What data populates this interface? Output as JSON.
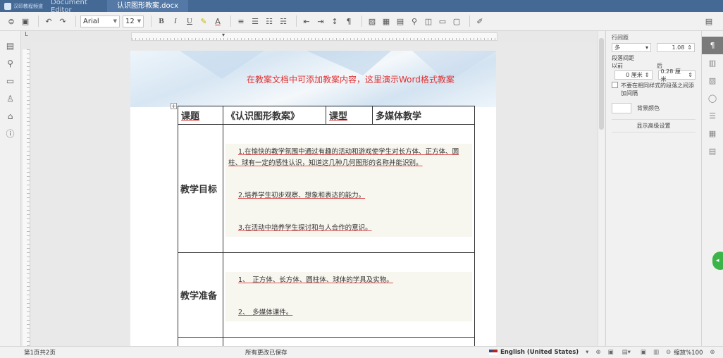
{
  "titlebar": {
    "logo_text": "汉印教程频道",
    "app_name": "Document Editor",
    "doc_tab": "认识图形教案.docx"
  },
  "toolbar": {
    "font_name": "Arial",
    "font_size": "12",
    "bold": "B",
    "italic": "I",
    "underline": "U"
  },
  "banner_text": "在教案文档中可添加教案内容，这里演示Word格式教案",
  "table": {
    "header": [
      "课题",
      "《认识图形教案》",
      "课型",
      "多媒体教学"
    ],
    "goals_label": "教学目标",
    "goals": [
      "1.在愉快的教学氛围中通过有趣的活动和游戏使学生对长方体、正方体、圆柱、球有一定的感性认识，知道这几种几何图形的名称并能识别。",
      "2.培养学生初步观察、想象和表达的能力。",
      "3.在活动中培养学生探讨和与人合作的意识。"
    ],
    "prep_label": "教学准备",
    "prep": [
      "1、　正方体、长方体、圆柱体、球体的学具及实物。",
      "2、　多媒体课件。"
    ]
  },
  "right_panel": {
    "line_spacing_label": "行间距",
    "line_spacing_mode": "多",
    "line_spacing_value": "1.08",
    "para_spacing_label": "段落间距",
    "before_label": "以前",
    "after_label": "后",
    "before_value": "0 厘米",
    "after_value": "0.28 厘米",
    "no_spacing_text": "不要在相同样式的段落之间添加间隔",
    "bg_color_label": "背景颜色",
    "advanced_label": "显示高级设置"
  },
  "statusbar": {
    "pages": "第1页共2页",
    "saved": "所有更改已保存",
    "language": "English (United States)",
    "zoom": "缩放%100"
  }
}
